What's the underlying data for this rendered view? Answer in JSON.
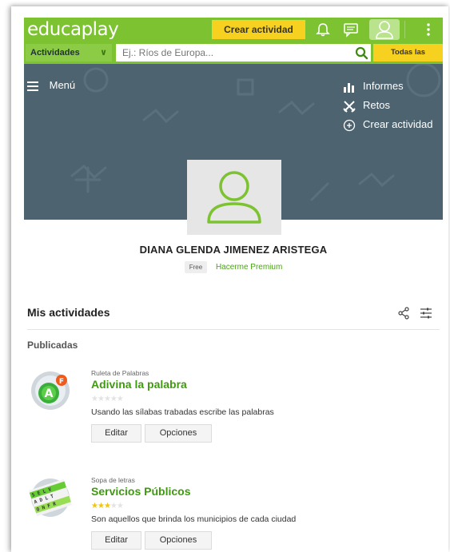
{
  "header": {
    "logo_text": "educaplay",
    "create_label": "Crear actividad"
  },
  "search": {
    "category_label": "Actividades",
    "placeholder": "Ej.: Ríos de Europa...",
    "all_activities_label": "Todas las actividades"
  },
  "banner": {
    "menu_label": "Menú",
    "links": [
      {
        "label": "Informes",
        "icon": "bar-chart-icon"
      },
      {
        "label": "Retos",
        "icon": "crossed-swords-icon"
      },
      {
        "label": "Crear actividad",
        "icon": "plus-circle-icon"
      }
    ]
  },
  "profile": {
    "name": "DIANA GLENDA JIMENEZ ARISTEGA",
    "plan_badge": "Free",
    "premium_link": "Hacerme Premium"
  },
  "activities_section": {
    "title": "Mis actividades",
    "subtitle": "Publicadas",
    "edit_label": "Editar",
    "options_label": "Opciones",
    "items": [
      {
        "type": "Ruleta de Palabras",
        "title": "Adivina la palabra",
        "rating": 0,
        "max_rating": 5,
        "description": "Usando las sílabas trabadas escribe las palabras"
      },
      {
        "type": "Sopa de letras",
        "title": "Servicios Públicos",
        "rating": 3,
        "max_rating": 5,
        "description": "Son aquellos que brinda los municipios de cada ciudad"
      }
    ]
  },
  "colors": {
    "brand_green": "#7cc231",
    "accent_yellow": "#f7d11f",
    "banner_slate": "#4e6370",
    "title_green": "#3f9a10"
  }
}
